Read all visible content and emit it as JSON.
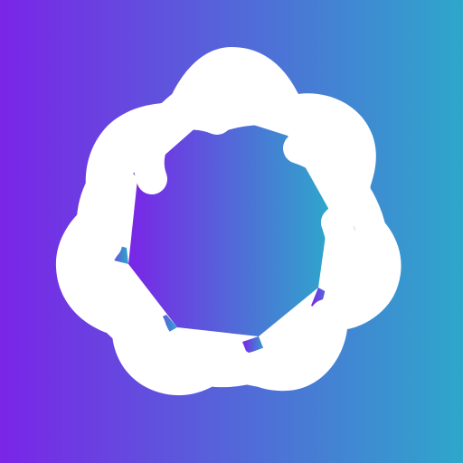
{
  "icon": {
    "name": "interwoven-knot-logo",
    "background_gradient": [
      "#7A25E7",
      "#2EA7CB"
    ],
    "foreground_color": "#FFFFFF"
  }
}
